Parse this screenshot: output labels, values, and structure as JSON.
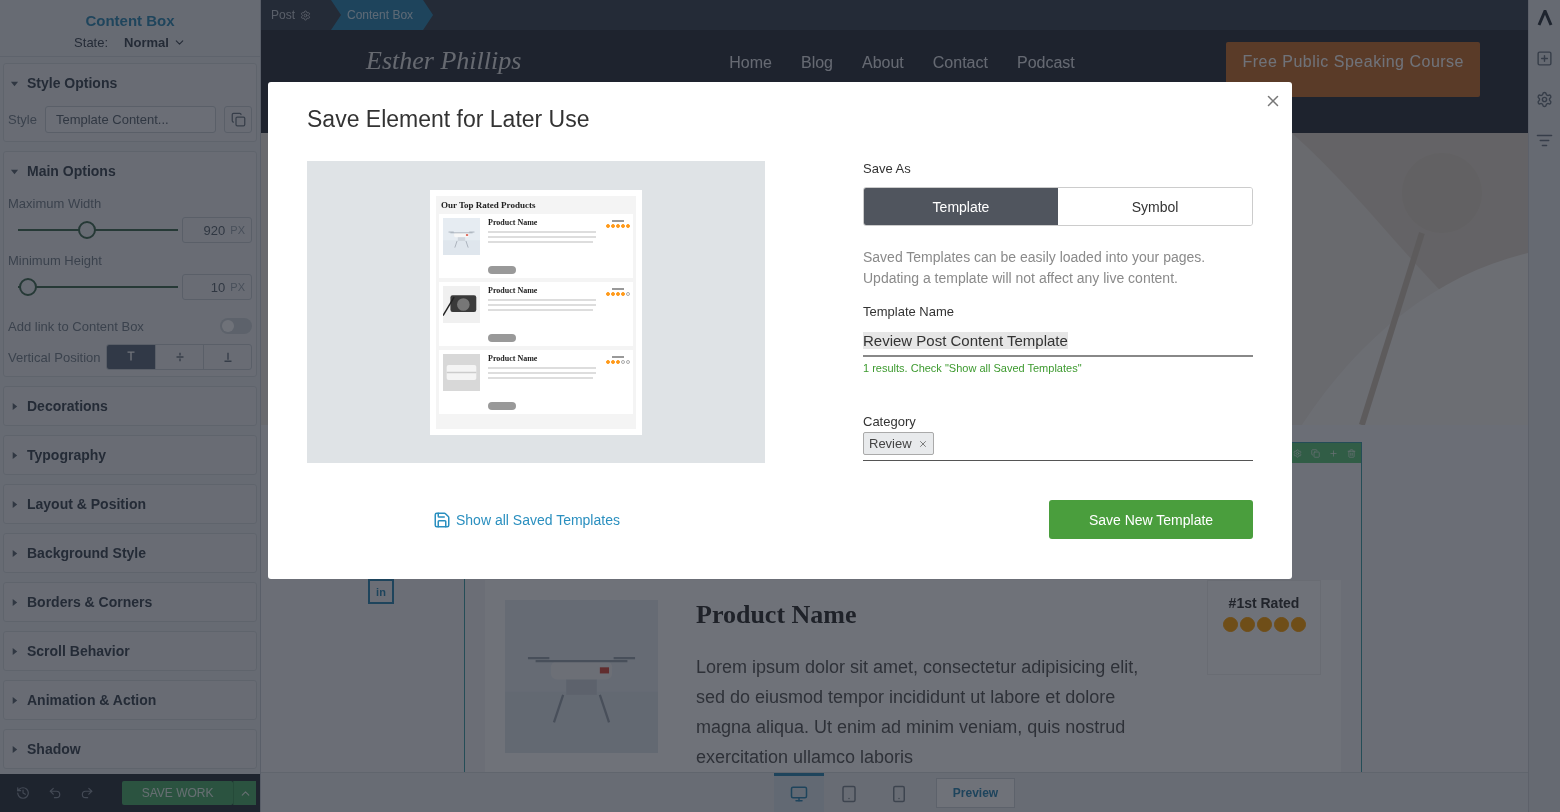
{
  "breadcrumb": [
    {
      "label": "Post",
      "selected": false
    },
    {
      "label": "Content Box",
      "selected": true
    }
  ],
  "panel": {
    "title": "Content Box",
    "state_label": "State:",
    "state_value": "Normal",
    "style_options": {
      "title": "Style Options",
      "expanded": true,
      "style_label": "Style",
      "style_value": "Template Content..."
    },
    "main_options": {
      "title": "Main Options",
      "expanded": true,
      "sliders": [
        {
          "label": "Maximum Width",
          "value": "920",
          "unit": "PX",
          "level": 0.43
        },
        {
          "label": "Minimum Height",
          "value": "10",
          "unit": "PX",
          "level": 0.06
        }
      ],
      "link_toggle": {
        "label": "Add link to Content Box",
        "on": false
      },
      "vertical_position": {
        "label": "Vertical Position",
        "options": [
          {
            "kind": "top",
            "selected": true
          },
          {
            "kind": "middle",
            "selected": false
          },
          {
            "kind": "bottom",
            "selected": false
          }
        ]
      }
    },
    "sections": [
      {
        "title": "Decorations",
        "expanded": false
      },
      {
        "title": "Typography",
        "expanded": false
      },
      {
        "title": "Layout & Position",
        "expanded": false
      },
      {
        "title": "Background Style",
        "expanded": false
      },
      {
        "title": "Borders & Corners",
        "expanded": false
      },
      {
        "title": "Scroll Behavior",
        "expanded": false
      },
      {
        "title": "Animation & Action",
        "expanded": false
      },
      {
        "title": "Shadow",
        "expanded": false
      }
    ],
    "save_button": "SAVE WORK"
  },
  "page": {
    "logo": "Esther Phillips",
    "nav": [
      "Home",
      "Blog",
      "About",
      "Contact",
      "Podcast"
    ],
    "cta": "Free Public Speaking Course",
    "social": "in",
    "product": {
      "title": "Product Name",
      "body": "Lorem ipsum dolor sit amet, consectetur adipisicing elit, sed do eiusmod tempor incididunt ut labore et dolore magna aliqua. Ut enim ad minim veniam, quis nostrud exercitation ullamco laboris",
      "rank": "#1st Rated",
      "stars": 5
    }
  },
  "bottom_toolbar": {
    "devices": [
      {
        "kind": "desktop",
        "selected": true
      },
      {
        "kind": "tablet",
        "selected": false
      },
      {
        "kind": "phone",
        "selected": false
      }
    ],
    "preview": "Preview"
  },
  "modal": {
    "title": "Save Element for Later Use",
    "preview": {
      "heading": "Our Top Rated Products",
      "products": [
        {
          "name": "Product Name",
          "stars": 5
        },
        {
          "name": "Product Name",
          "stars": 4
        },
        {
          "name": "Product Name",
          "stars": 3
        }
      ]
    },
    "save_as_label": "Save As",
    "options": [
      {
        "label": "Template",
        "selected": true
      },
      {
        "label": "Symbol",
        "selected": false
      }
    ],
    "description": [
      "Saved Templates can be easily loaded into your pages.",
      "Updating a template will not affect any live content."
    ],
    "name_label": "Template Name",
    "name_value": "Review Post Content Template",
    "hint": "1 results. Check \"Show all Saved Templates\"",
    "category_label": "Category",
    "tags": [
      "Review"
    ],
    "link": "Show all Saved Templates",
    "submit": "Save New Template"
  }
}
